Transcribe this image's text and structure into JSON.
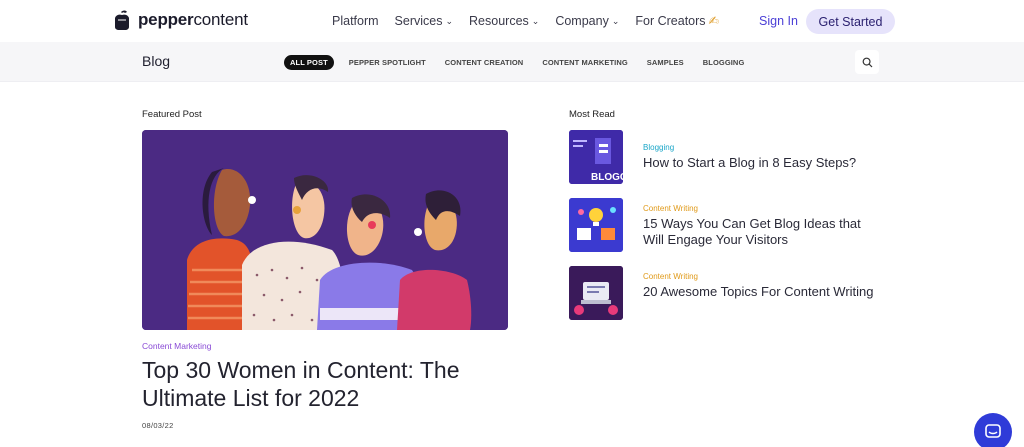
{
  "brand": {
    "name_part1": "pepper",
    "name_part2": "content"
  },
  "nav": {
    "items": [
      {
        "label": "Platform",
        "has_dropdown": false
      },
      {
        "label": "Services",
        "has_dropdown": true
      },
      {
        "label": "Resources",
        "has_dropdown": true
      },
      {
        "label": "Company",
        "has_dropdown": true
      },
      {
        "label": "For Creators",
        "has_dropdown": false
      }
    ],
    "creators_emoji": "✍",
    "sign_in": "Sign In",
    "get_started": "Get Started"
  },
  "subnav": {
    "title": "Blog",
    "categories": [
      "ALL POST",
      "PEPPER SPOTLIGHT",
      "CONTENT CREATION",
      "CONTENT MARKETING",
      "SAMPLES",
      "BLOGGING"
    ],
    "active_category": "ALL POST"
  },
  "featured": {
    "section_label": "Featured Post",
    "category": "Content Marketing",
    "title": "Top 30 Women in Content: The Ultimate List for 2022",
    "date": "08/03/22"
  },
  "most_read": {
    "section_label": "Most Read",
    "items": [
      {
        "category": "Blogging",
        "category_color": "#1aa6c8",
        "title": "How to Start a Blog in 8 Easy Steps?",
        "thumb_text": "BLOGG"
      },
      {
        "category": "Content Writing",
        "category_color": "#e09a1a",
        "title": "15 Ways You Can Get Blog Ideas that Will Engage Your Visitors"
      },
      {
        "category": "Content Writing",
        "category_color": "#e09a1a",
        "title": "20 Awesome Topics For Content Writing"
      }
    ]
  },
  "colors": {
    "accent": "#4b3fd6",
    "chat": "#2f3bd8",
    "featured_bg": "#4b2a83"
  }
}
